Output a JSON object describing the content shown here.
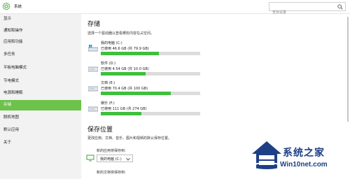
{
  "header": {
    "title": "系统",
    "search_placeholder": "查找设置"
  },
  "sidebar": {
    "items": [
      {
        "label": "显示"
      },
      {
        "label": "通知和操作"
      },
      {
        "label": "应用和功能"
      },
      {
        "label": "多任务"
      },
      {
        "label": "平板电脑模式"
      },
      {
        "label": "节电模式"
      },
      {
        "label": "电源和睡眠"
      },
      {
        "label": "存储",
        "active": true
      },
      {
        "label": "脱机地图"
      },
      {
        "label": "默认应用"
      },
      {
        "label": "关于"
      }
    ]
  },
  "storage": {
    "title": "存储",
    "description": "选择一个驱动器以查看哪些内容在占空间。",
    "drives": [
      {
        "name": "我的电脑 (C:)",
        "used": "已使用 46.6 GB (共 79.9 GB)",
        "fraction": 0.583,
        "icon": "windows-drive-icon"
      },
      {
        "name": "软件 (D:)",
        "used": "已使用 4.54 GB (共 10.0 GB)",
        "fraction": 0.454,
        "icon": "drive-icon"
      },
      {
        "name": "文档 (E:)",
        "used": "已使用 70.4 GB (共 100 GB)",
        "fraction": 0.704,
        "icon": "drive-icon"
      },
      {
        "name": "娱乐 (F:)",
        "used": "已使用 111 GB (共 274 GB)",
        "fraction": 0.405,
        "icon": "drive-icon"
      }
    ]
  },
  "save_locations": {
    "title": "保存位置",
    "description": "更改应用、文档、音乐、图片和视频的默认保存位置。",
    "apps_label": "新的应用将保存到:",
    "apps_value": "我的电脑 (C:)",
    "docs_label": "新的文档将保存到:"
  },
  "watermark": {
    "cn": "系统之家",
    "en": "Win10net.com"
  },
  "colors": {
    "accent": "#6cc24a",
    "bar_fill": "#3fbf3f",
    "bar_track": "#dcdcdc"
  }
}
